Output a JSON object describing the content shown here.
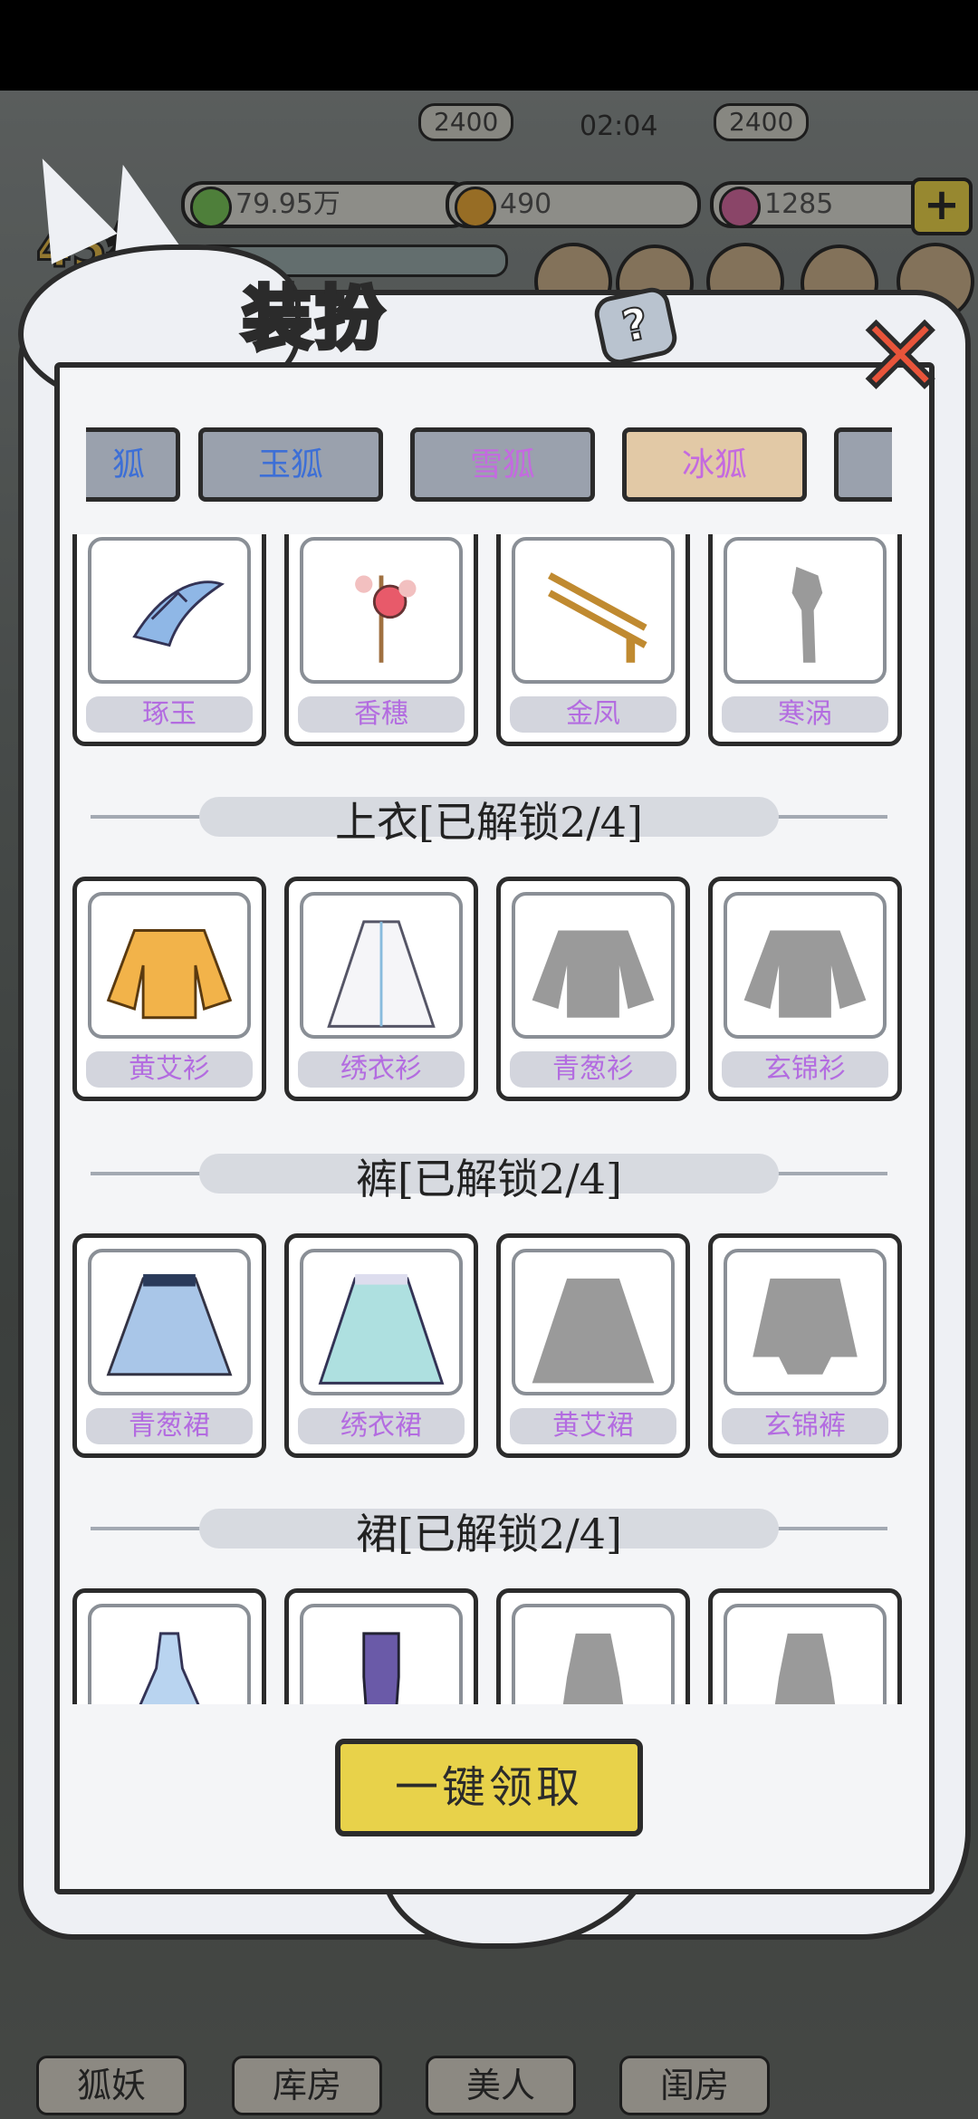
{
  "hud": {
    "counter_left": "2400",
    "counter_right": "2400",
    "timer": "02:04",
    "resource_1": "79.95万",
    "resource_2": "490",
    "resource_3": "1285",
    "plus": "+",
    "level": "45级"
  },
  "popup": {
    "title": "装扮",
    "help": "?",
    "close": "✕",
    "claim_button": "一键领取"
  },
  "tabs": [
    {
      "label": "狐",
      "color": "#3d6fd6"
    },
    {
      "label": "玉狐",
      "color": "#3d6fd6"
    },
    {
      "label": "雪狐",
      "color": "#c46ae0"
    },
    {
      "label": "冰狐",
      "color": "#c46ae0",
      "selected": true
    },
    {
      "label": "",
      "color": "#3d6fd6"
    }
  ],
  "sections": [
    {
      "header": "",
      "items": [
        {
          "label": "琢玉",
          "icon": "blue-feather-hairpin-icon",
          "locked": false
        },
        {
          "label": "香穗",
          "icon": "flower-hairpin-icon",
          "locked": false
        },
        {
          "label": "金凤",
          "icon": "gold-hairpin-icon",
          "locked": false
        },
        {
          "label": "寒涡",
          "icon": "locked-hairpin-silhouette-icon",
          "locked": true
        }
      ]
    },
    {
      "header": "上衣[已解锁2/4]",
      "items": [
        {
          "label": "黄艾衫",
          "icon": "yellow-top-icon",
          "locked": false
        },
        {
          "label": "绣衣衫",
          "icon": "white-robe-icon",
          "locked": false
        },
        {
          "label": "青葱衫",
          "icon": "locked-top-silhouette-icon",
          "locked": true
        },
        {
          "label": "玄锦衫",
          "icon": "locked-top-silhouette-icon",
          "locked": true
        }
      ]
    },
    {
      "header": "裤[已解锁2/4]",
      "items": [
        {
          "label": "青葱裙",
          "icon": "blue-skirt-icon",
          "locked": false
        },
        {
          "label": "绣衣裙",
          "icon": "teal-skirt-icon",
          "locked": false
        },
        {
          "label": "黄艾裙",
          "icon": "locked-skirt-silhouette-icon",
          "locked": true
        },
        {
          "label": "玄锦裤",
          "icon": "locked-pants-silhouette-icon",
          "locked": true
        }
      ]
    },
    {
      "header": "裙[已解锁2/4]",
      "items": [
        {
          "label": "",
          "icon": "blue-dress-icon",
          "locked": false
        },
        {
          "label": "",
          "icon": "purple-dress-icon",
          "locked": false
        },
        {
          "label": "",
          "icon": "locked-dress-silhouette-icon",
          "locked": true
        },
        {
          "label": "",
          "icon": "locked-dress-silhouette-icon",
          "locked": true
        }
      ]
    }
  ],
  "bottom_nav": [
    {
      "label": "狐妖"
    },
    {
      "label": "库房"
    },
    {
      "label": "美人"
    },
    {
      "label": "闺房"
    }
  ]
}
